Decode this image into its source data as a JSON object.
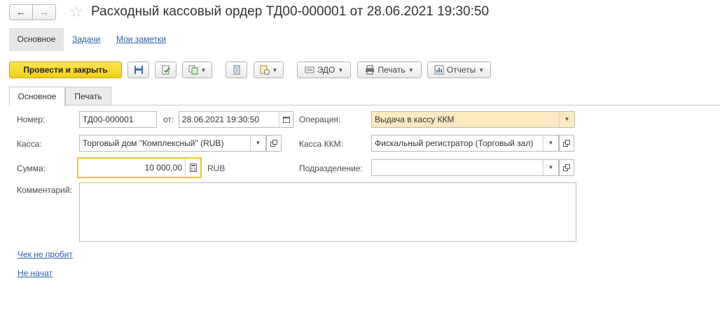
{
  "window": {
    "title": "Расходный кассовый ордер ТД00-000001 от 28.06.2021 19:30:50"
  },
  "sections": {
    "main": "Основное",
    "tasks": "Задачи",
    "notes": "Мои заметки"
  },
  "toolbar": {
    "post_close": "Провести и закрыть",
    "edo": "ЭДО",
    "print": "Печать",
    "reports": "Отчеты"
  },
  "tabs": {
    "main": "Основное",
    "print": "Печать"
  },
  "form": {
    "number_label": "Номер:",
    "number_value": "ТД00-000001",
    "date_label": "от:",
    "date_value": "28.06.2021 19:30:50",
    "operation_label": "Операция:",
    "operation_value": "Выдача в кассу ККМ",
    "kassa_label": "Касса:",
    "kassa_value": "Торговый дом \"Комплексный\" (RUB)",
    "kassa_kkm_label": "Касса ККМ:",
    "kassa_kkm_value": "Фискальный регистратор (Торговый зал)",
    "sum_label": "Сумма:",
    "sum_value": "10 000,00",
    "currency": "RUB",
    "division_label": "Подразделение:",
    "division_value": "",
    "comment_label": "Комментарий:",
    "comment_value": ""
  },
  "links": {
    "check": "Чек не пробит",
    "status": "Не начат"
  },
  "colors": {
    "primary_button": "#f2cf16",
    "operation_bg": "#fbe9bf",
    "focus_border": "#f2c31b",
    "link": "#2b5fa6"
  }
}
